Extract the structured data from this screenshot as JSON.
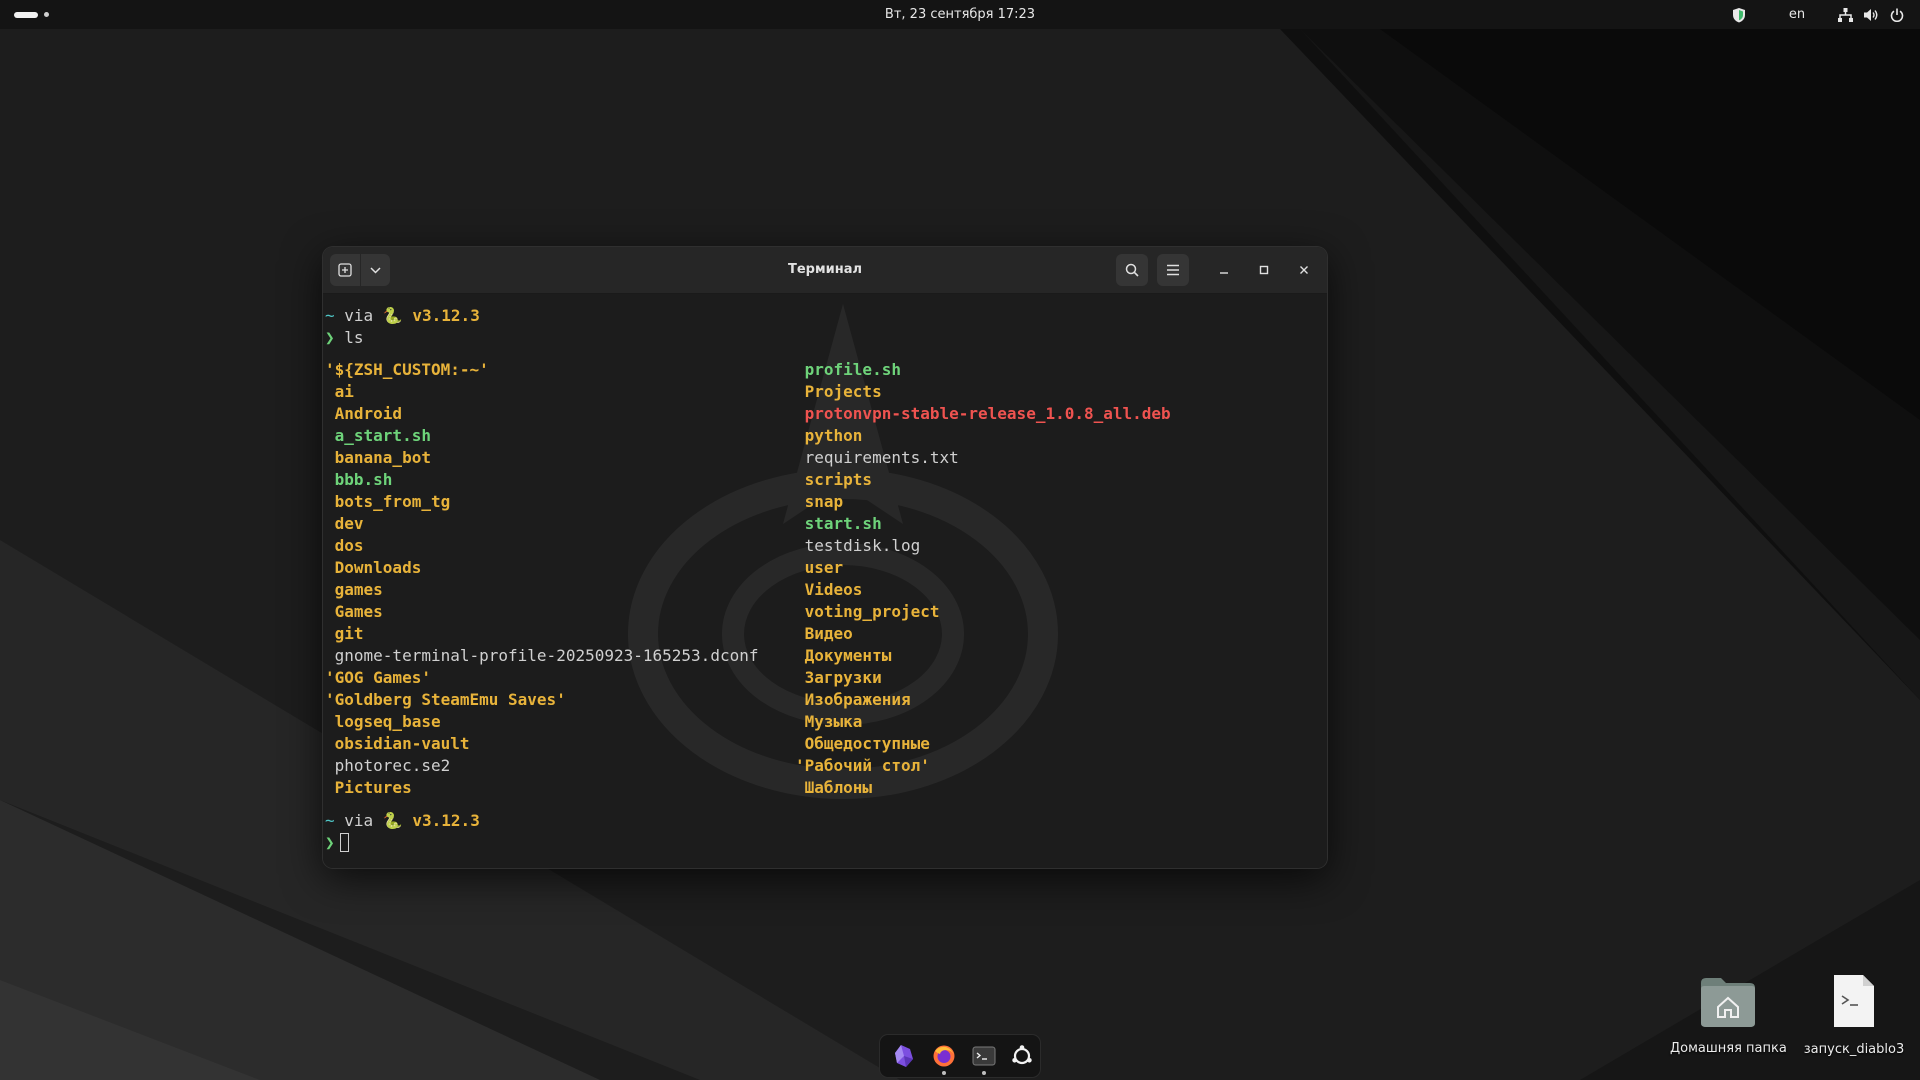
{
  "topbar": {
    "datetime": "Вт, 23 сентября  17:23",
    "language": "en",
    "icons": [
      "shield-icon",
      "network-icon",
      "volume-icon",
      "power-icon"
    ]
  },
  "window": {
    "title": "Терминал",
    "buttons": [
      "new-tab-icon",
      "chevron-down-icon",
      "search-icon",
      "menu-icon",
      "minimize-icon",
      "maximize-icon",
      "close-icon"
    ]
  },
  "terminal": {
    "prompt": {
      "tilde": "~",
      "via": "via",
      "python_icon": "🐍",
      "version": "v3.12.3",
      "arrow": "❯"
    },
    "command": "ls",
    "colors": {
      "dir": "#e8b33a",
      "exec": "#6ed37a",
      "file": "#d0d0d0",
      "archive": "#ef5350",
      "tilde": "#4fc7c7"
    },
    "left_column": [
      {
        "name": "'${ZSH_CUSTOM:-~'",
        "type": "dir"
      },
      {
        "name": " ai",
        "type": "dir"
      },
      {
        "name": " Android",
        "type": "dir"
      },
      {
        "name": " a_start.sh",
        "type": "exec"
      },
      {
        "name": " banana_bot",
        "type": "dir"
      },
      {
        "name": " bbb.sh",
        "type": "exec"
      },
      {
        "name": " bots_from_tg",
        "type": "dir"
      },
      {
        "name": " dev",
        "type": "dir"
      },
      {
        "name": " dos",
        "type": "dir"
      },
      {
        "name": " Downloads",
        "type": "dir"
      },
      {
        "name": " games",
        "type": "dir"
      },
      {
        "name": " Games",
        "type": "dir"
      },
      {
        "name": " git",
        "type": "dir"
      },
      {
        "name": " gnome-terminal-profile-20250923-165253.dconf",
        "type": "file"
      },
      {
        "name": "'GOG Games'",
        "type": "dir"
      },
      {
        "name": "'Goldberg SteamEmu Saves'",
        "type": "dir"
      },
      {
        "name": " logseq_base",
        "type": "dir"
      },
      {
        "name": " obsidian-vault",
        "type": "dir"
      },
      {
        "name": " photorec.se2",
        "type": "file"
      },
      {
        "name": " Pictures",
        "type": "dir"
      }
    ],
    "right_column": [
      {
        "name": " profile.sh",
        "type": "exec"
      },
      {
        "name": " Projects",
        "type": "dir"
      },
      {
        "name": " protonvpn-stable-release_1.0.8_all.deb",
        "type": "archive"
      },
      {
        "name": " python",
        "type": "dir"
      },
      {
        "name": " requirements.txt",
        "type": "file"
      },
      {
        "name": " scripts",
        "type": "dir"
      },
      {
        "name": " snap",
        "type": "dir"
      },
      {
        "name": " start.sh",
        "type": "exec"
      },
      {
        "name": " testdisk.log",
        "type": "file"
      },
      {
        "name": " user",
        "type": "dir"
      },
      {
        "name": " Videos",
        "type": "dir"
      },
      {
        "name": " voting_project",
        "type": "dir"
      },
      {
        "name": " Видео",
        "type": "dir"
      },
      {
        "name": " Документы",
        "type": "dir"
      },
      {
        "name": " Загрузки",
        "type": "dir"
      },
      {
        "name": " Изображения",
        "type": "dir"
      },
      {
        "name": " Музыка",
        "type": "dir"
      },
      {
        "name": " Общедоступные",
        "type": "dir"
      },
      {
        "name": "'Рабочий стол'",
        "type": "dir"
      },
      {
        "name": " Шаблоны",
        "type": "dir"
      }
    ]
  },
  "dock": {
    "apps": [
      {
        "name": "obsidian-icon",
        "running": false
      },
      {
        "name": "firefox-icon",
        "running": true
      },
      {
        "name": "terminal-icon",
        "running": true
      },
      {
        "name": "settings-icon",
        "running": false
      }
    ]
  },
  "desktop": {
    "icons": [
      {
        "label": "Домашняя папка",
        "icon": "home-folder-icon"
      },
      {
        "label": "запуск_diablo3",
        "icon": "script-file-icon"
      }
    ]
  }
}
